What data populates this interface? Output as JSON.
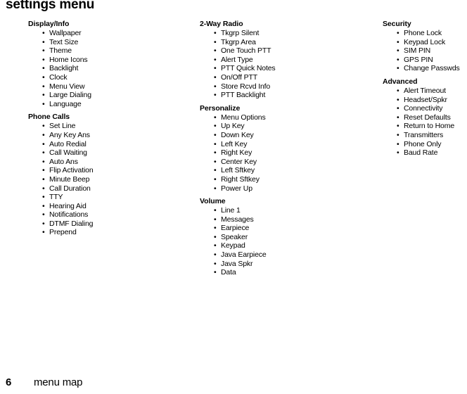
{
  "page": {
    "title": "settings menu",
    "bullet_glyph": "•"
  },
  "columns": [
    {
      "id": "column-1",
      "sections": [
        {
          "heading": "Display/Info",
          "items": [
            "Wallpaper",
            "Text Size",
            "Theme",
            "Home Icons",
            "Backlight",
            "Clock",
            "Menu View",
            "Large Dialing",
            "Language"
          ]
        },
        {
          "heading": "Phone Calls",
          "items": [
            "Set Line",
            "Any Key Ans",
            "Auto Redial",
            "Call Waiting",
            "Auto Ans",
            "Flip Activation",
            "Minute Beep",
            "Call Duration",
            "TTY",
            "Hearing Aid",
            "Notifications",
            "DTMF Dialing",
            "Prepend"
          ]
        }
      ]
    },
    {
      "id": "column-2",
      "sections": [
        {
          "heading": "2-Way Radio",
          "items": [
            "Tkgrp Silent",
            "Tkgrp Area",
            "One Touch PTT",
            "Alert Type",
            "PTT Quick Notes",
            "On/Off PTT",
            "Store Rcvd Info",
            "PTT Backlight"
          ]
        },
        {
          "heading": "Personalize",
          "items": [
            "Menu Options",
            "Up Key",
            "Down Key",
            "Left Key",
            "Right Key",
            "Center Key",
            "Left Sftkey",
            "Right Sftkey",
            "Power Up"
          ]
        },
        {
          "heading": "Volume",
          "items": [
            "Line 1",
            "Messages",
            "Earpiece",
            "Speaker",
            "Keypad",
            "Java Earpiece",
            "Java Spkr",
            "Data"
          ]
        }
      ]
    },
    {
      "id": "column-3",
      "sections": [
        {
          "heading": "Security",
          "items": [
            "Phone Lock",
            "Keypad Lock",
            "SIM PIN",
            "GPS PIN",
            "Change Passwds"
          ]
        },
        {
          "heading": "Advanced",
          "items": [
            "Alert Timeout",
            "Headset/Spkr",
            "Connectivity",
            "Reset Defaults",
            "Return to Home",
            "Transmitters",
            "Phone Only",
            "Baud Rate"
          ]
        }
      ]
    }
  ],
  "footer": {
    "page_number": "6",
    "section_label": "menu map"
  }
}
